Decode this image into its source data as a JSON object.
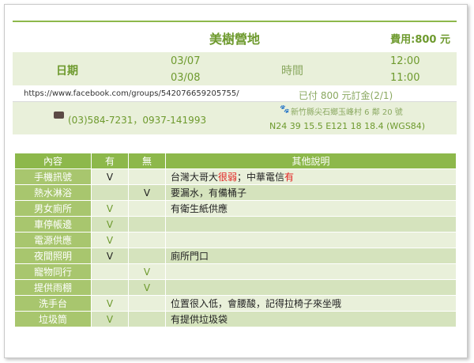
{
  "header": {
    "title": "美樹營地",
    "fee": "費用:800 元"
  },
  "dates": {
    "label": "日期",
    "checkin_date": "03/07",
    "checkout_date": "03/08",
    "time_label": "時間",
    "checkin_time": "12:00",
    "checkout_time": "11:00"
  },
  "info": {
    "url": "https://www.facebook.com/groups/542076659205755/",
    "deposit": "已付 800 元訂金(2/1)",
    "phone": "(03)584-7231，0937-141993",
    "address": "新竹縣尖石鄉玉峰村 6 鄰 20 號",
    "coords": "N24 39 15.5 E121 18 18.4 (WGS84)"
  },
  "table": {
    "headers": [
      "內容",
      "有",
      "無",
      "其他說明"
    ],
    "rows": [
      {
        "item": "手機訊號",
        "yes": "V",
        "no": "",
        "note_pre": "台灣大哥大",
        "note_red": "很弱",
        "note_mid": "；中華電信",
        "note_red2": "有"
      },
      {
        "item": "熱水淋浴",
        "yes": "",
        "no": "V",
        "note_pre": "要漏水，有備桶子",
        "note_red": "",
        "note_mid": "",
        "note_red2": ""
      },
      {
        "item": "男女廁所",
        "yes": "V",
        "no": "",
        "note_pre": "有衛生紙供應",
        "note_red": "",
        "note_mid": "",
        "note_red2": ""
      },
      {
        "item": "車停帳邊",
        "yes": "V",
        "no": "",
        "note_pre": "",
        "note_red": "",
        "note_mid": "",
        "note_red2": ""
      },
      {
        "item": "電源供應",
        "yes": "V",
        "no": "",
        "note_pre": "",
        "note_red": "",
        "note_mid": "",
        "note_red2": ""
      },
      {
        "item": "夜間照明",
        "yes": "V",
        "no": "",
        "note_pre": "廁所門口",
        "note_red": "",
        "note_mid": "",
        "note_red2": ""
      },
      {
        "item": "寵物同行",
        "yes": "",
        "no": "V",
        "note_pre": "",
        "note_red": "",
        "note_mid": "",
        "note_red2": ""
      },
      {
        "item": "提供雨棚",
        "yes": "",
        "no": "V",
        "note_pre": "",
        "note_red": "",
        "note_mid": "",
        "note_red2": ""
      },
      {
        "item": "洗手台",
        "yes": "V",
        "no": "",
        "note_pre": "位置很入低，會腰酸，記得拉椅子來坐哦",
        "note_red": "",
        "note_mid": "",
        "note_red2": ""
      },
      {
        "item": "垃圾筒",
        "yes": "V",
        "no": "",
        "note_pre": "有提供垃圾袋",
        "note_red": "",
        "note_mid": "",
        "note_red2": ""
      }
    ]
  },
  "colors": {
    "accent": "#6e9a2e",
    "header_bg": "#8db84b",
    "item_bg": "#a8c66e",
    "row_light": "#e9f0da",
    "row_dark": "#d5e3bd",
    "warn": "#e22020"
  },
  "icons": [
    "photo-icon",
    "paw-icon"
  ]
}
